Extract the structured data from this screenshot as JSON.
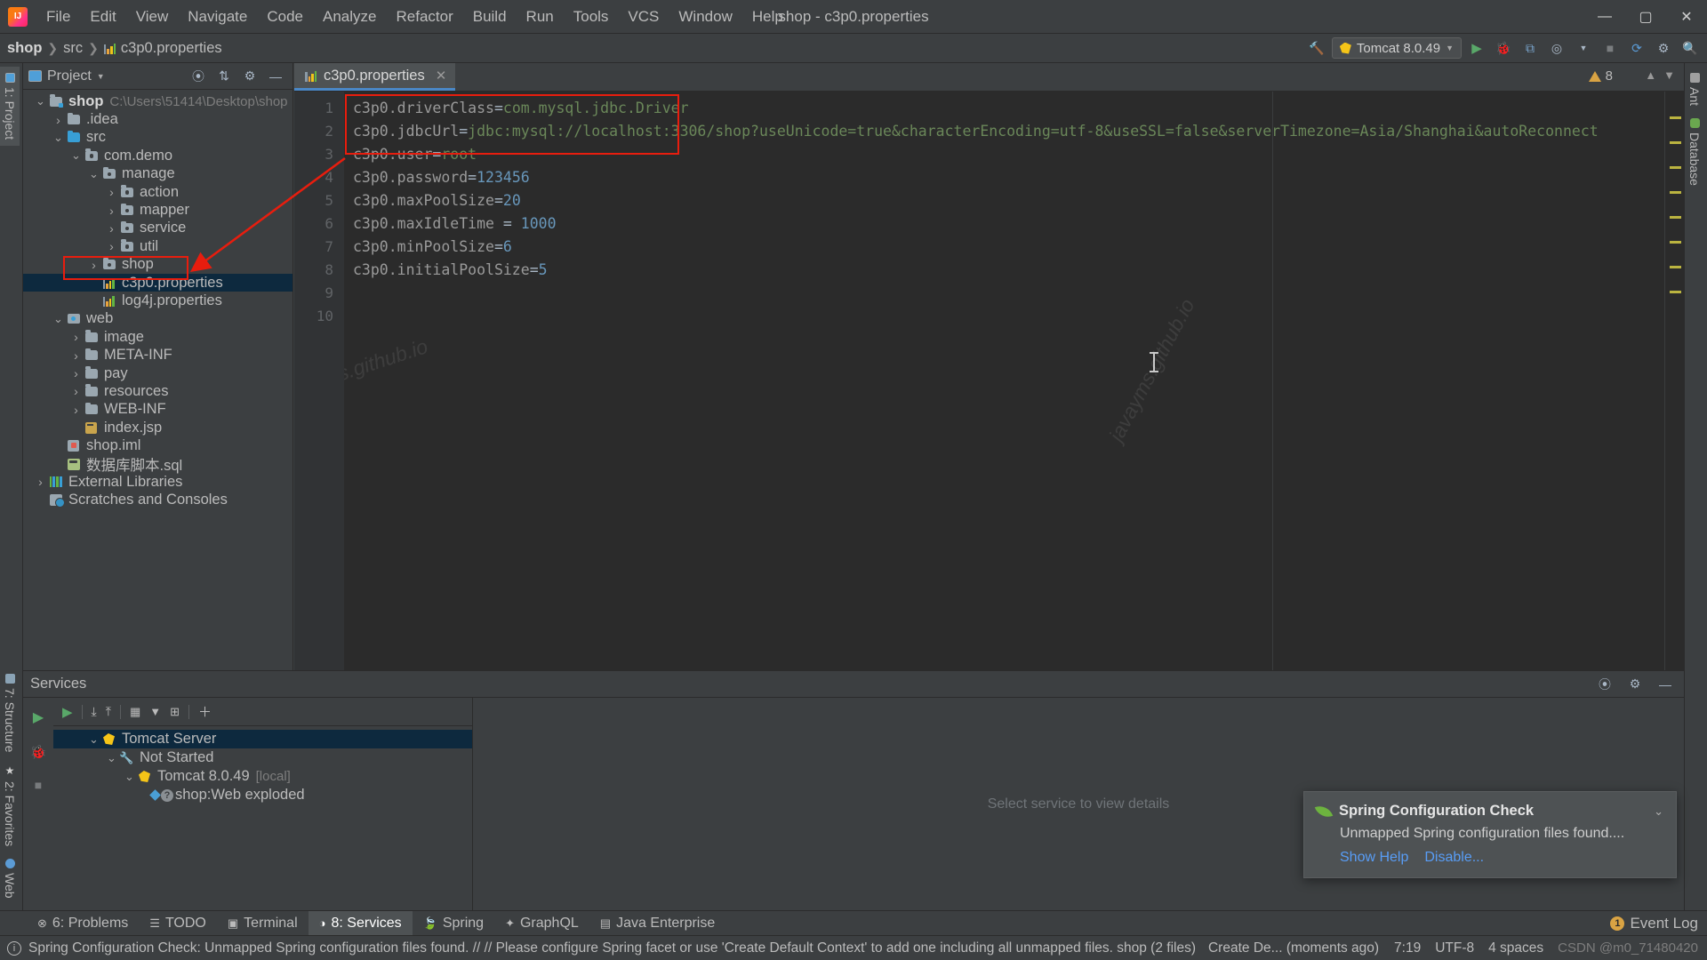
{
  "window": {
    "title": "shop - c3p0.properties",
    "controls": {
      "minimize": "—",
      "maximize": "▢",
      "close": "✕"
    }
  },
  "menubar": [
    "File",
    "Edit",
    "View",
    "Navigate",
    "Code",
    "Analyze",
    "Refactor",
    "Build",
    "Run",
    "Tools",
    "VCS",
    "Window",
    "Help"
  ],
  "breadcrumb": {
    "project": "shop",
    "folder": "src",
    "file": "c3p0.properties"
  },
  "toolbar": {
    "run_config": "Tomcat 8.0.49",
    "hammer_icon": "build-icon",
    "run_icon": "run-icon",
    "debug_icon": "debug-icon",
    "coverage_icon": "run-with-coverage-icon",
    "profile_icon": "profiler-icon",
    "stop_icon": "stop-icon",
    "updates_icon": "update-project-icon",
    "settings_icon": "settings-icon",
    "search_icon": "search-everywhere-icon"
  },
  "left_stripe": {
    "top": [
      "1: Project"
    ],
    "bottom": [
      "7: Structure",
      "2: Favorites",
      "Web"
    ]
  },
  "right_stripe": [
    "Ant",
    "Database"
  ],
  "project_panel": {
    "title": "Project",
    "collapse_icon": "collapse-all-icon",
    "locate_icon": "select-opened-file-icon",
    "settings_icon": "gear-icon",
    "hide_icon": "hide-icon",
    "tree": [
      {
        "label": "shop",
        "secondary": "C:\\Users\\51414\\Desktop\\shop",
        "indent": 0,
        "arrow": "down",
        "icon": "module-folder",
        "bold": true
      },
      {
        "label": ".idea",
        "indent": 1,
        "arrow": "right",
        "icon": "folder-grey"
      },
      {
        "label": "src",
        "indent": 1,
        "arrow": "down",
        "icon": "folder-blue"
      },
      {
        "label": "com.demo",
        "indent": 2,
        "arrow": "down",
        "icon": "package"
      },
      {
        "label": "manage",
        "indent": 3,
        "arrow": "down",
        "icon": "package"
      },
      {
        "label": "action",
        "indent": 4,
        "arrow": "right",
        "icon": "package"
      },
      {
        "label": "mapper",
        "indent": 4,
        "arrow": "right",
        "icon": "package"
      },
      {
        "label": "service",
        "indent": 4,
        "arrow": "right",
        "icon": "package"
      },
      {
        "label": "util",
        "indent": 4,
        "arrow": "right",
        "icon": "package"
      },
      {
        "label": "shop",
        "indent": 3,
        "arrow": "right",
        "icon": "package"
      },
      {
        "label": "c3p0.properties",
        "indent": 3,
        "arrow": "none",
        "icon": "properties",
        "selected": true
      },
      {
        "label": "log4j.properties",
        "indent": 3,
        "arrow": "none",
        "icon": "properties"
      },
      {
        "label": "web",
        "indent": 1,
        "arrow": "down",
        "icon": "module-root"
      },
      {
        "label": "image",
        "indent": 2,
        "arrow": "right",
        "icon": "folder-grey"
      },
      {
        "label": "META-INF",
        "indent": 2,
        "arrow": "right",
        "icon": "folder-grey"
      },
      {
        "label": "pay",
        "indent": 2,
        "arrow": "right",
        "icon": "folder-grey"
      },
      {
        "label": "resources",
        "indent": 2,
        "arrow": "right",
        "icon": "folder-grey"
      },
      {
        "label": "WEB-INF",
        "indent": 2,
        "arrow": "right",
        "icon": "folder-grey"
      },
      {
        "label": "index.jsp",
        "indent": 2,
        "arrow": "none",
        "icon": "jsp"
      },
      {
        "label": "shop.iml",
        "indent": 1,
        "arrow": "none",
        "icon": "iml"
      },
      {
        "label": "数据库脚本.sql",
        "indent": 1,
        "arrow": "none",
        "icon": "sql"
      },
      {
        "label": "External Libraries",
        "indent": 0,
        "arrow": "right",
        "icon": "libraries"
      },
      {
        "label": "Scratches and Consoles",
        "indent": 0,
        "arrow": "none",
        "icon": "scratches"
      }
    ]
  },
  "editor": {
    "tab": {
      "label": "c3p0.properties",
      "icon": "properties-file-icon",
      "close": "✕"
    },
    "warnings_count": "8",
    "warning_icon": "warning-triangle-icon",
    "prev_icon": "▲",
    "next_icon": "▼",
    "line_numbers": [
      "1",
      "2",
      "3",
      "4",
      "5",
      "6",
      "7",
      "8",
      "9",
      "10"
    ],
    "lines": [
      {
        "key": "c3p0.driverClass",
        "op": "=",
        "value": "com.mysql.jdbc.Driver",
        "value_type": "string"
      },
      {
        "key": "c3p0.jdbcUrl",
        "op": "=",
        "value": "jdbc:mysql://localhost:3306/shop?useUnicode=true&characterEncoding=utf-8&useSSL=false&serverTimezone=Asia/Shanghai&autoReconnect",
        "value_type": "string"
      },
      {
        "key": "c3p0.user",
        "op": "=",
        "value": "root",
        "value_type": "string"
      },
      {
        "key": "c3p0.password",
        "op": "=",
        "value": "123456",
        "value_type": "number"
      },
      {
        "key": "c3p0.maxPoolSize",
        "op": "=",
        "value": "20",
        "value_type": "number"
      },
      {
        "key": "c3p0.maxIdleTime",
        "op": " = ",
        "value": "1000",
        "value_type": "number"
      },
      {
        "key": "c3p0.minPoolSize",
        "op": "=",
        "value": "6",
        "value_type": "number"
      },
      {
        "key": "c3p0.initialPoolSize",
        "op": "=",
        "value": "5",
        "value_type": "number"
      },
      {
        "key": "",
        "op": "",
        "value": "",
        "value_type": "none"
      },
      {
        "key": "",
        "op": "",
        "value": "",
        "value_type": "none"
      }
    ],
    "watermarks": [
      "javayms.github.io",
      "javayms.github.io"
    ]
  },
  "services": {
    "title": "Services",
    "settings_icon": "gear-icon",
    "help_icon": "help-icon",
    "hide_icon": "hide-icon",
    "rail_icons": [
      "run-icon",
      "debug-icon",
      "stop-icon"
    ],
    "toolbar_icons": [
      "run-icon",
      "expand-all-icon",
      "collapse-all-icon",
      "group-icon",
      "filter-icon",
      "add-tab-icon",
      "add-icon"
    ],
    "tree": [
      {
        "label": "Tomcat Server",
        "indent": 0,
        "arrow": "down",
        "icon": "tomcat",
        "selected": true
      },
      {
        "label": "Not Started",
        "indent": 1,
        "arrow": "down",
        "icon": "wrench"
      },
      {
        "label": "Tomcat 8.0.49",
        "secondary": "[local]",
        "indent": 2,
        "arrow": "down",
        "icon": "tomcat-stopped"
      },
      {
        "label": "shop:Web exploded",
        "indent": 3,
        "arrow": "none",
        "icon": "artifact"
      }
    ],
    "empty_detail": "Select service to view details"
  },
  "notification": {
    "icon": "spring-leaf-icon",
    "title": "Spring Configuration Check",
    "message": "Unmapped Spring configuration files found....",
    "links": [
      "Show Help",
      "Disable..."
    ],
    "collapse_icon": "⌄"
  },
  "bottom_tabs": [
    {
      "label": "6: Problems",
      "num": "6",
      "icon": "problems-icon",
      "active": false
    },
    {
      "label": "TODO",
      "icon": "todo-icon",
      "active": false
    },
    {
      "label": "Terminal",
      "icon": "terminal-icon",
      "active": false
    },
    {
      "label": "8: Services",
      "num": "8",
      "icon": "services-icon",
      "active": true
    },
    {
      "label": "Spring",
      "icon": "spring-icon",
      "active": false
    },
    {
      "label": "GraphQL",
      "icon": "graphql-icon",
      "active": false
    },
    {
      "label": "Java Enterprise",
      "icon": "java-enterprise-icon",
      "active": false
    }
  ],
  "event_log": {
    "label": "Event Log",
    "badge": "1"
  },
  "statusbar": {
    "icon": "info-icon",
    "message": "Spring Configuration Check: Unmapped Spring configuration files found. // // Please configure Spring facet or use 'Create Default Context' to add one including all unmapped files. shop (2 files)",
    "secondary": "Create De... (moments ago)",
    "position": "7:19",
    "encoding": "UTF-8",
    "indent": "4 spaces",
    "watermark": "CSDN @m0_71480420"
  },
  "colors": {
    "bg": "#3c3f41",
    "editor_bg": "#2b2b2b",
    "accent": "#4a88c7",
    "selection": "#0d293e",
    "string": "#6a8759",
    "number": "#6897bb",
    "key": "#9a9a9a",
    "link": "#589df6",
    "annotation_red": "#e81d0e",
    "warning": "#d9a343"
  }
}
